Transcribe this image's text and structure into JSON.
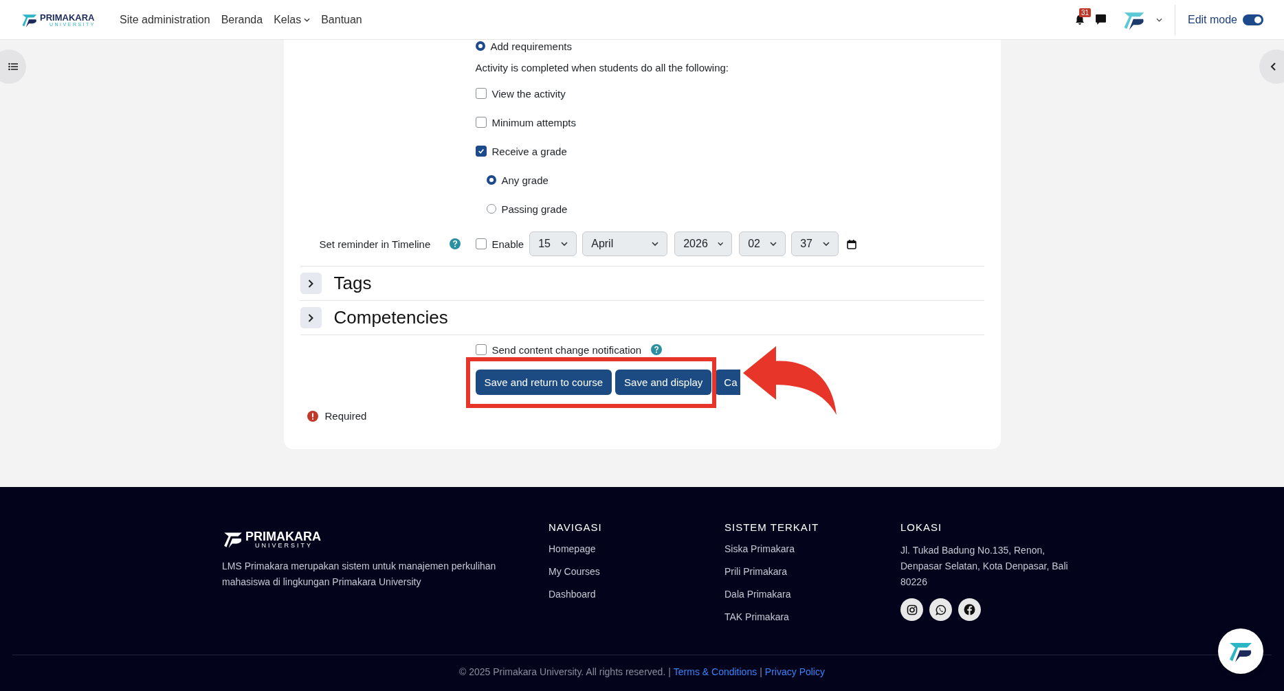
{
  "header": {
    "logo": {
      "name": "PRIMAKARA",
      "sub": "UNIVERSITY"
    },
    "nav": [
      {
        "label": "Site administration",
        "dropdown": false
      },
      {
        "label": "Beranda",
        "dropdown": false
      },
      {
        "label": "Kelas",
        "dropdown": true
      },
      {
        "label": "Bantuan",
        "dropdown": false
      }
    ],
    "notification_count": "31",
    "edit_mode": {
      "label": "Edit mode",
      "on": true
    }
  },
  "completion": {
    "add_requirements": {
      "label": "Add requirements",
      "selected": true
    },
    "intro": "Activity is completed when students do all the following:",
    "conditions": [
      {
        "label": "View the activity",
        "checked": false
      },
      {
        "label": "Minimum attempts",
        "checked": false
      },
      {
        "label": "Receive a grade",
        "checked": true,
        "options": [
          {
            "label": "Any grade",
            "selected": true
          },
          {
            "label": "Passing grade",
            "selected": false
          }
        ]
      }
    ]
  },
  "reminder": {
    "label": "Set reminder in Timeline",
    "enable": {
      "label": "Enable",
      "checked": false
    },
    "selects": [
      "15",
      "April",
      "2026",
      "02",
      "37"
    ]
  },
  "sections": [
    {
      "title": "Tags",
      "expanded": false
    },
    {
      "title": "Competencies",
      "expanded": false
    }
  ],
  "notify": {
    "label": "Send content change notification",
    "checked": false
  },
  "buttons": [
    "Save and return to course",
    "Save and display",
    "Ca"
  ],
  "required": "Required",
  "footer": {
    "logo": {
      "name": "PRIMAKARA",
      "sub": "UNIVERSITY"
    },
    "description": "LMS Primakara merupakan sistem untuk manajemen perkulihan mahasiswa di lingkungan Primakara University",
    "columns": [
      {
        "heading": "NAVIGASI",
        "links": [
          "Homepage",
          "My Courses",
          "Dashboard"
        ]
      },
      {
        "heading": "SISTEM TERKAIT",
        "links": [
          "Siska Primakara",
          "Prili Primakara",
          "Dala Primakara",
          "TAK Primakara"
        ]
      }
    ],
    "location": {
      "heading": "LOKASI",
      "address": "Jl. Tukad Badung No.135, Renon, Denpasar Selatan, Kota Denpasar, Bali 80226"
    },
    "copyright": "© 2025 Primakara University. All rights reserved. |",
    "links": [
      "Terms & Conditions",
      "Privacy Policy"
    ],
    "link_separator": "|"
  }
}
